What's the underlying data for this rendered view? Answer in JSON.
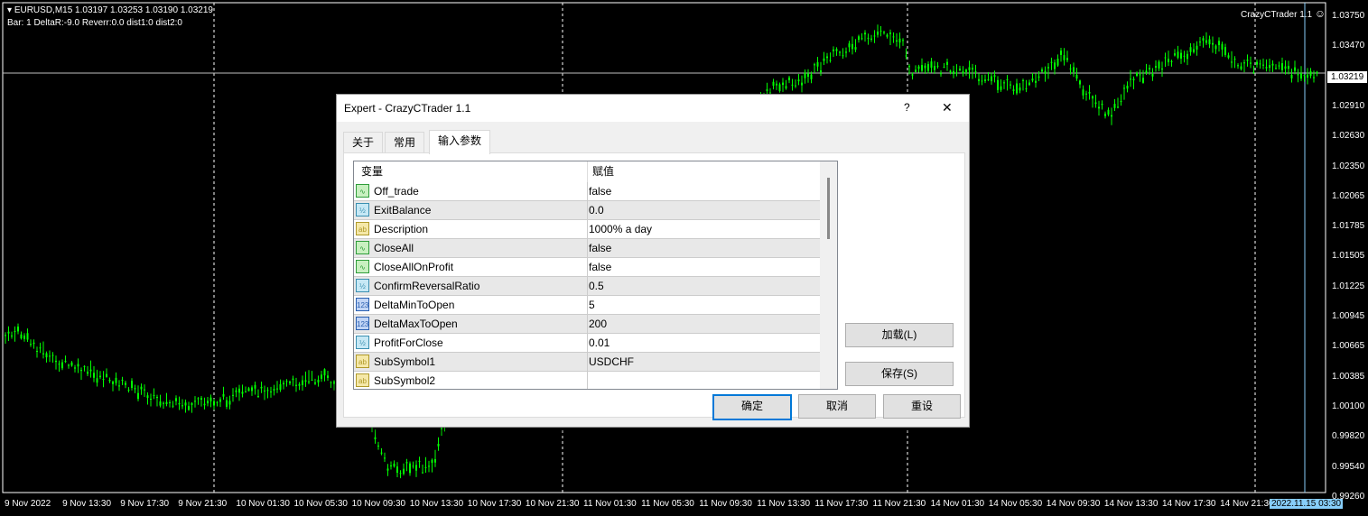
{
  "chart": {
    "symbol_line": "EURUSD,M15  1.03197 1.03253 1.03190 1.03219",
    "indicator_line": "Bar: 1 DeltaR:-9.0 Reverr:0.0 dist1:0 dist2:0",
    "expert_label": "CrazyCTrader 1.1",
    "expert_icon": "smiley-icon",
    "current_price": "1.03219",
    "price_axis": [
      "1.03750",
      "1.03470",
      "1.03219",
      "1.02910",
      "1.02630",
      "1.02350",
      "1.02065",
      "1.01785",
      "1.01505",
      "1.01225",
      "1.00945",
      "1.00665",
      "1.00385",
      "1.00100",
      "0.99820",
      "0.99540",
      "0.99260"
    ],
    "time_axis": [
      "9 Nov 2022",
      "9 Nov 13:30",
      "9 Nov 17:30",
      "9 Nov 21:30",
      "10 Nov 01:30",
      "10 Nov 05:30",
      "10 Nov 09:30",
      "10 Nov 13:30",
      "10 Nov 17:30",
      "10 Nov 21:30",
      "11 Nov 01:30",
      "11 Nov 05:30",
      "11 Nov 09:30",
      "11 Nov 13:30",
      "11 Nov 17:30",
      "11 Nov 21:30",
      "14 Nov 01:30",
      "14 Nov 05:30",
      "14 Nov 09:30",
      "14 Nov 13:30",
      "14 Nov 17:30",
      "14 Nov 21:30"
    ],
    "crosshair_time": "2022.11.15 03:30",
    "colors": {
      "background": "#000000",
      "candle": "#00ff00",
      "crosshair": "#87cefa"
    }
  },
  "dialog": {
    "title": "Expert - CrazyCTrader 1.1",
    "help": "?",
    "close": "✕",
    "tabs": [
      "关于",
      "常用",
      "输入参数"
    ],
    "active_tab": 2,
    "columns": [
      "变量",
      "赋值"
    ],
    "rows": [
      {
        "icon": "bool",
        "name": "Off_trade",
        "value": "false"
      },
      {
        "icon": "double",
        "name": "ExitBalance",
        "value": "0.0"
      },
      {
        "icon": "string",
        "name": "Description",
        "value": "1000% a day"
      },
      {
        "icon": "bool",
        "name": "CloseAll",
        "value": "false"
      },
      {
        "icon": "bool",
        "name": "CloseAllOnProfit",
        "value": "false"
      },
      {
        "icon": "double",
        "name": "ConfirmReversalRatio",
        "value": "0.5"
      },
      {
        "icon": "int",
        "name": "DeltaMinToOpen",
        "value": "5"
      },
      {
        "icon": "int",
        "name": "DeltaMaxToOpen",
        "value": "200"
      },
      {
        "icon": "double",
        "name": "ProfitForClose",
        "value": "0.01"
      },
      {
        "icon": "string",
        "name": "SubSymbol1",
        "value": "USDCHF"
      },
      {
        "icon": "string",
        "name": "SubSymbol2",
        "value": ""
      }
    ],
    "load": "加载(L)",
    "save": "保存(S)",
    "ok": "确定",
    "cancel": "取消",
    "reset": "重设"
  }
}
